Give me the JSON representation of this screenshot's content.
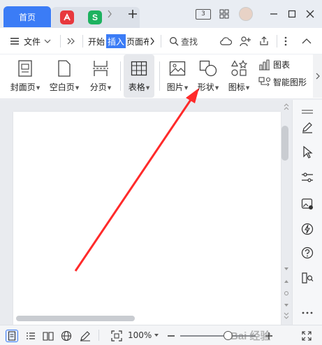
{
  "titlebar": {
    "home_tab": "首页",
    "app_tab_1_letter": "",
    "app_tab_2_letter": "S",
    "badge_text": "3",
    "colors": {
      "home_tab": "#3b7cf6",
      "app1": "#e8383d",
      "app2": "#1db25f"
    }
  },
  "menubar": {
    "file": "文件",
    "start": "开始",
    "insert": "插入",
    "page": "页面布",
    "search": "查找"
  },
  "ribbon": {
    "cover": "封面页",
    "blank": "空白页",
    "pagebreak": "分页",
    "table": "表格",
    "picture": "图片",
    "shape": "形状",
    "icons": "图标",
    "chart": "图表",
    "smartart": "智能图形"
  },
  "statusbar": {
    "zoom": "100%"
  },
  "watermark": "Bai 经验"
}
